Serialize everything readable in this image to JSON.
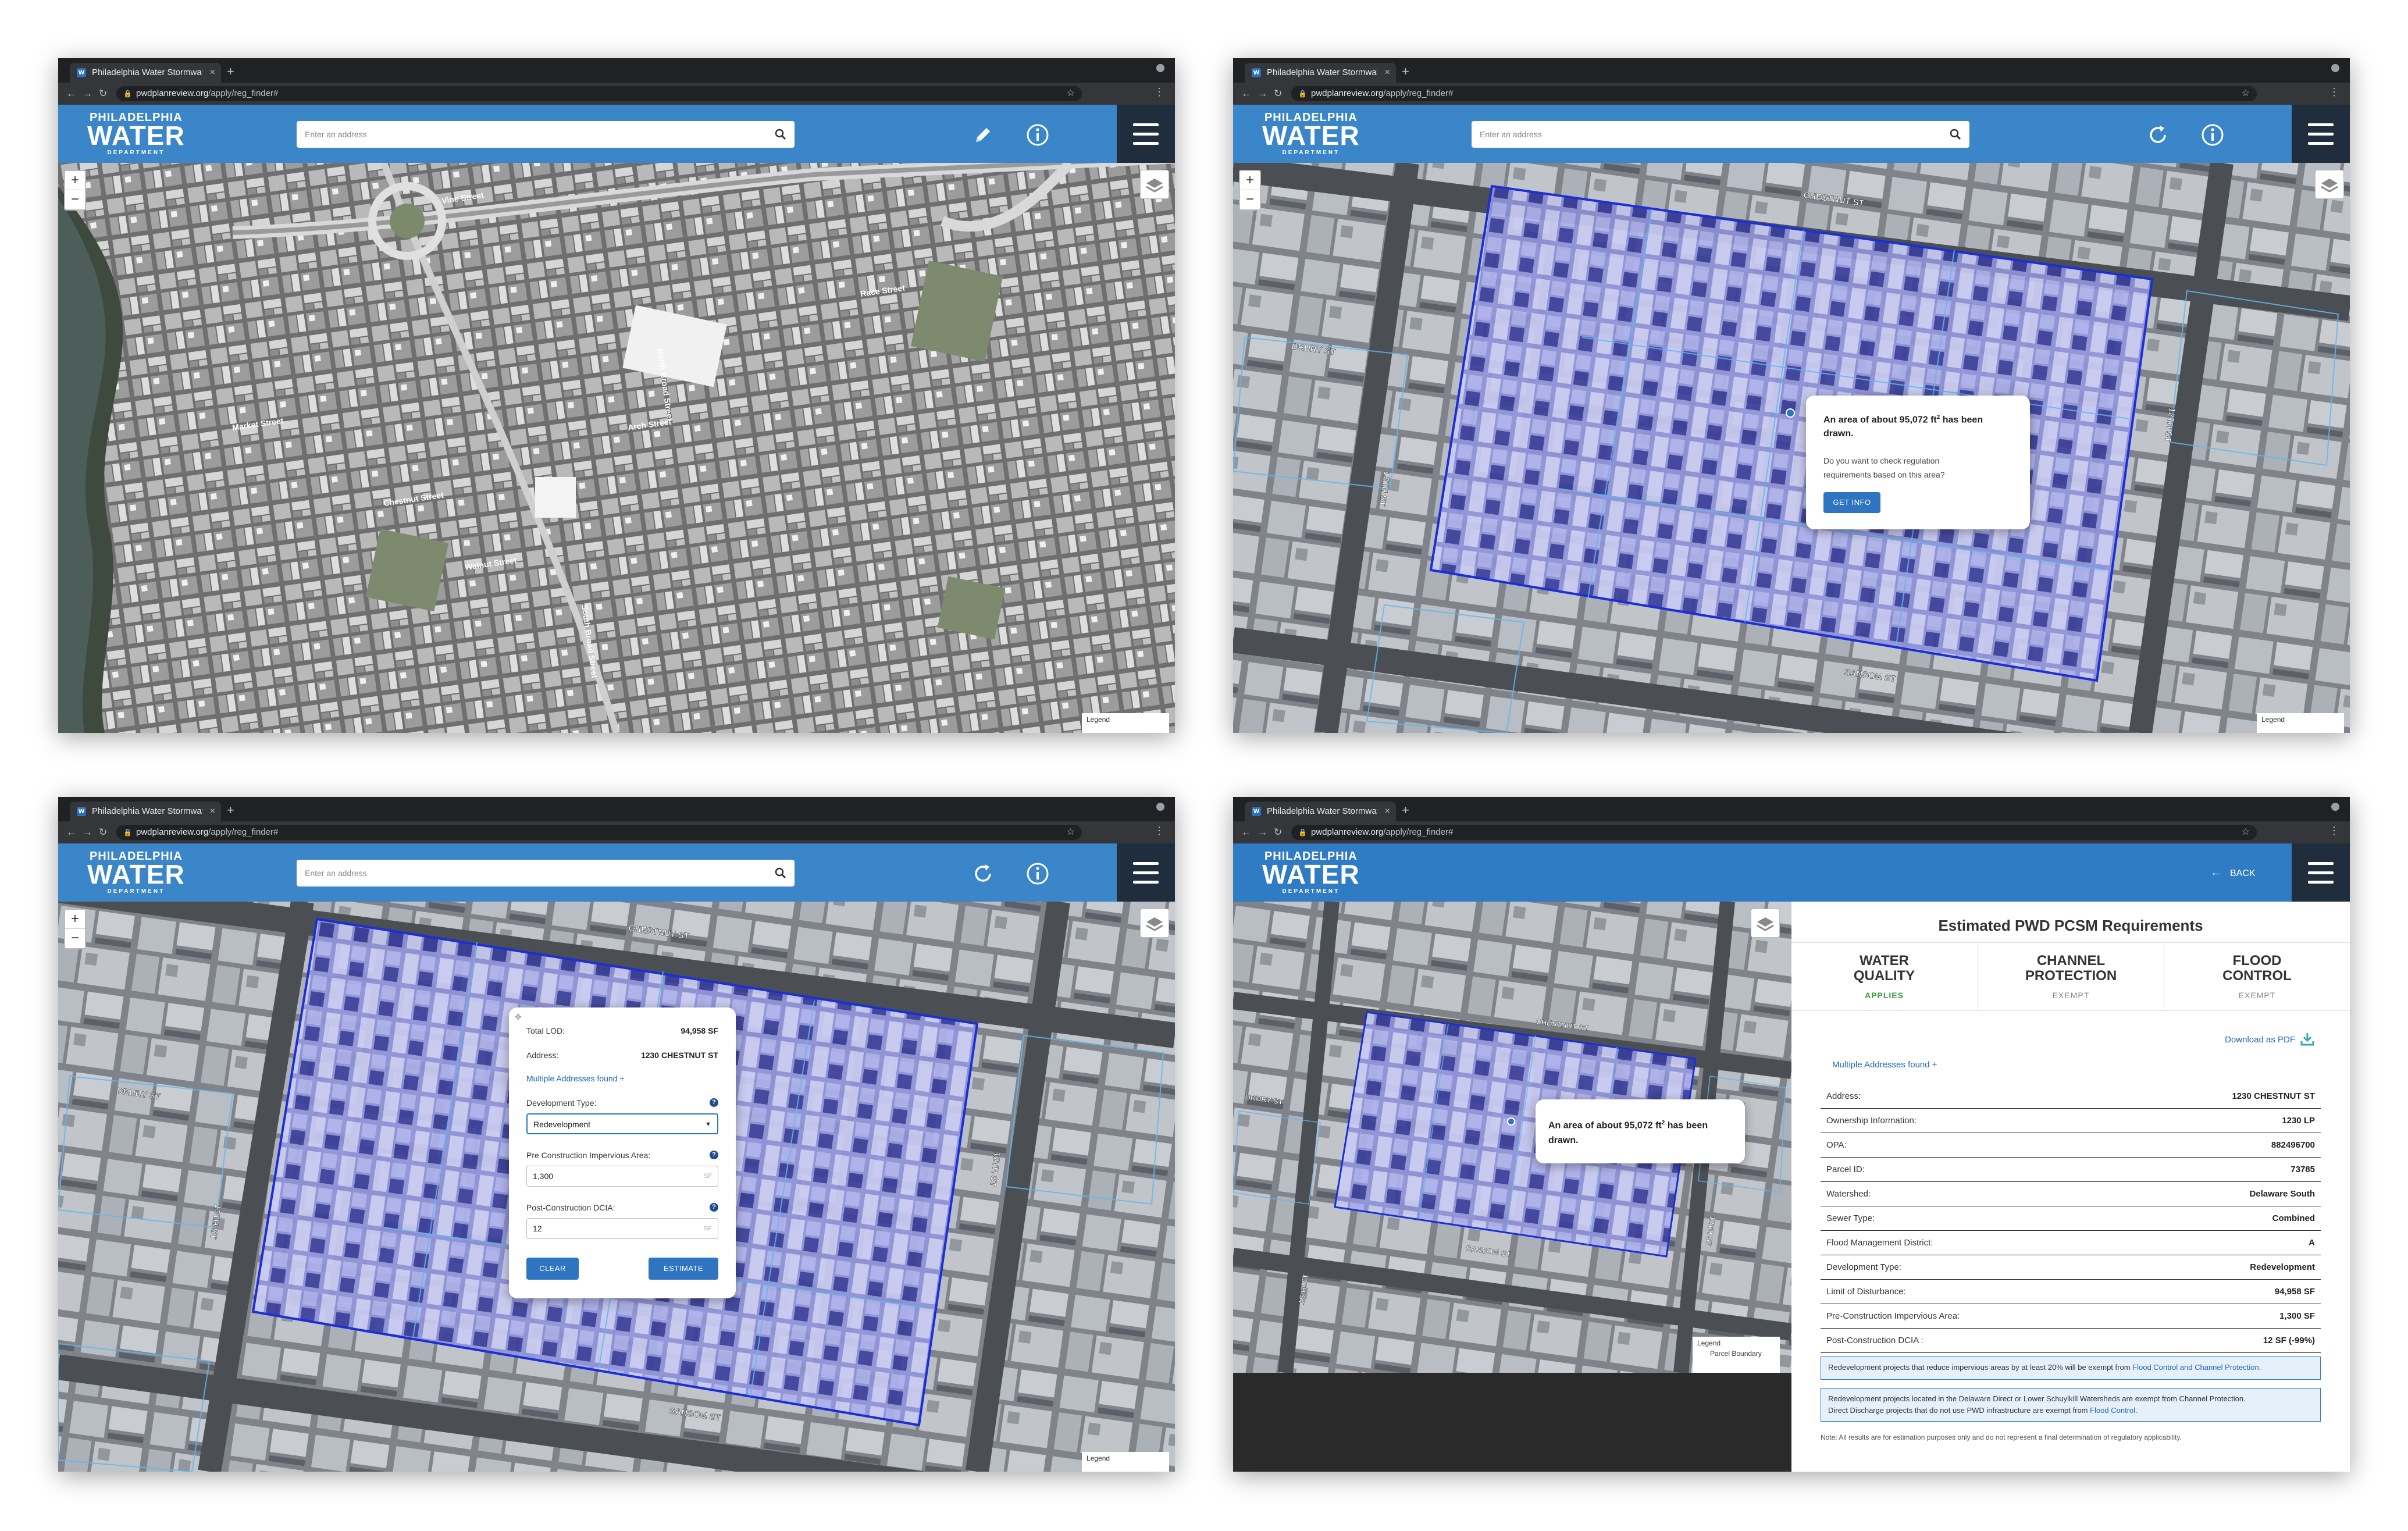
{
  "browser": {
    "tab_title": "Philadelphia Water Stormwate",
    "tab_close": "×",
    "new_tab": "+",
    "url_domain": "pwdplanreview.org",
    "url_path": "/apply/reg_finder#"
  },
  "header": {
    "logo_line1": "PHILADELPHIA",
    "logo_line2": "WATER",
    "logo_line3": "DEPARTMENT",
    "search_placeholder": "Enter an address",
    "back_label": "BACK"
  },
  "map": {
    "zoom_in": "+",
    "zoom_out": "−",
    "legend_title": "Legend",
    "legend_item": "Parcel Boundary",
    "streets_overview": [
      "Vine Street",
      "Race Street",
      "Arch Street",
      "Market Street",
      "Chestnut Street",
      "Walnut Street",
      "North Broad Street",
      "South Broad Street"
    ],
    "streets_parcel": [
      "CHESTNUT ST",
      "SANSOM ST",
      "DRURY ST",
      "13TH ST",
      "12TH ST"
    ]
  },
  "draw_popup": {
    "line1_pre": "An area of about 95,072 ft",
    "sup": "2",
    "line1_post": " has been",
    "line2": "drawn.",
    "question_1": "Do you want to check regulation",
    "question_2": "requirements based on this area?",
    "button": "GET INFO"
  },
  "form_popup": {
    "total_lod_label": "Total LOD:",
    "total_lod_value": "94,958 SF",
    "address_label": "Address:",
    "address_value": "1230 CHESTNUT ST",
    "multiple_addresses": "Multiple Addresses found +",
    "dev_type_label": "Development Type:",
    "dev_type_value": "Redevelopment",
    "pre_label": "Pre Construction Impervious Area:",
    "pre_value": "1,300",
    "post_label": "Post-Construction DCIA:",
    "post_value": "12",
    "unit": "SF",
    "help": "?",
    "clear": "CLEAR",
    "estimate": "ESTIMATE"
  },
  "results": {
    "title": "Estimated PWD PCSM Requirements",
    "categories": [
      {
        "line1": "WATER",
        "line2": "QUALITY",
        "status": "APPLIES",
        "color": "#3a9a3a"
      },
      {
        "line1": "CHANNEL",
        "line2": "PROTECTION",
        "status": "EXEMPT",
        "color": "#888888"
      },
      {
        "line1": "FLOOD",
        "line2": "CONTROL",
        "status": "EXEMPT",
        "color": "#888888"
      }
    ],
    "download": "Download as PDF",
    "multiple_addresses": "Multiple Addresses found +",
    "rows": [
      {
        "label": "Address:",
        "value": "1230 CHESTNUT ST"
      },
      {
        "label": "Ownership Information:",
        "value": "1230 LP"
      },
      {
        "label": "OPA:",
        "value": "882496700"
      },
      {
        "label": "Parcel ID:",
        "value": "73785"
      },
      {
        "label": "Watershed:",
        "value": "Delaware South"
      },
      {
        "label": "Sewer Type:",
        "value": "Combined"
      },
      {
        "label": "Flood Management District:",
        "value": "A"
      },
      {
        "label": "Development Type:",
        "value": "Redevelopment"
      },
      {
        "label": "Limit of Disturbance:",
        "value": "94,958 SF"
      },
      {
        "label": "Pre-Construction Impervious Area:",
        "value": "1,300 SF"
      },
      {
        "label": "Post-Construction DCIA :",
        "value": "12 SF (-99%)"
      }
    ],
    "notice1_text": "Redevelopment projects that reduce impervious areas by at least 20% will be exempt from ",
    "notice1_link": "Flood Control and Channel Protection.",
    "notice2_line1": "Redevelopment projects located in the Delaware Direct or Lower Schuylkill Watersheds are exempt from Channel Protection.",
    "notice2_line2": "Direct Discharge projects that do not use PWD infrastructure are exempt from ",
    "notice2_link": "Flood Control.",
    "note": "Note: All results are for estimation purposes only and do not represent a final determination of regulatory applicability."
  },
  "colors": {
    "header_blue": "#3a86c8",
    "menu_dark": "#1f2d3d",
    "button_blue": "#2f74c0",
    "parcel_outline": "#1a2fd6",
    "applies_green": "#3a9a3a"
  }
}
